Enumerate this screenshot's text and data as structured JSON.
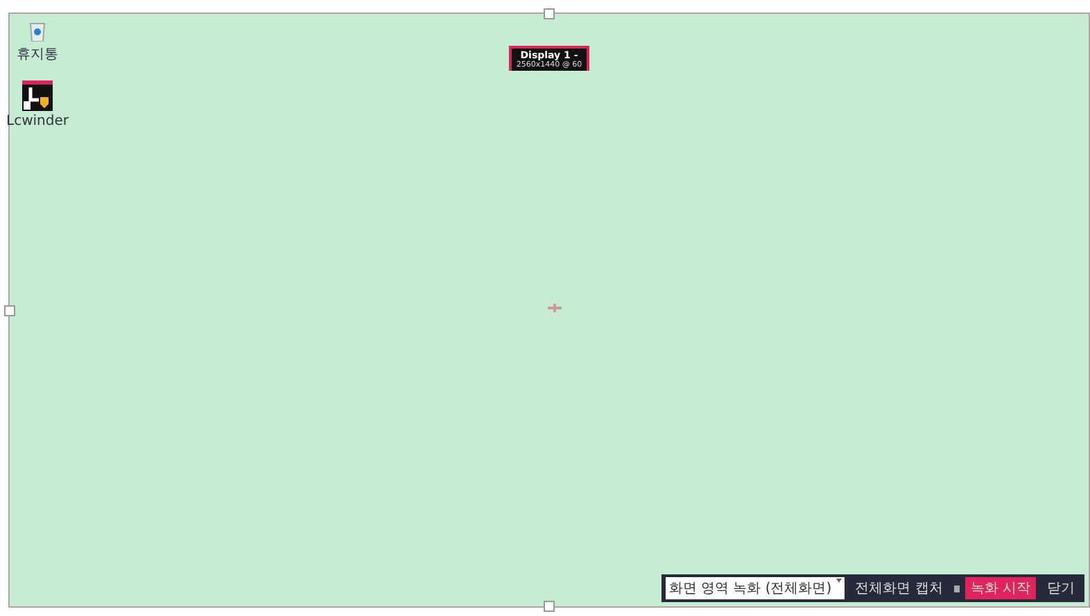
{
  "desktop_icons": [
    {
      "kind": "trash",
      "label": "휴지통"
    },
    {
      "kind": "app",
      "label": "Lcwinder"
    }
  ],
  "display_label": {
    "title": "Display 1 -",
    "resolution": "2560x1440 @ 60"
  },
  "toolbar": {
    "select": "화면 영역 녹화 (전체화면)",
    "capture": "전체화면 캡처",
    "record": "녹화 시작",
    "close": "닫기"
  }
}
